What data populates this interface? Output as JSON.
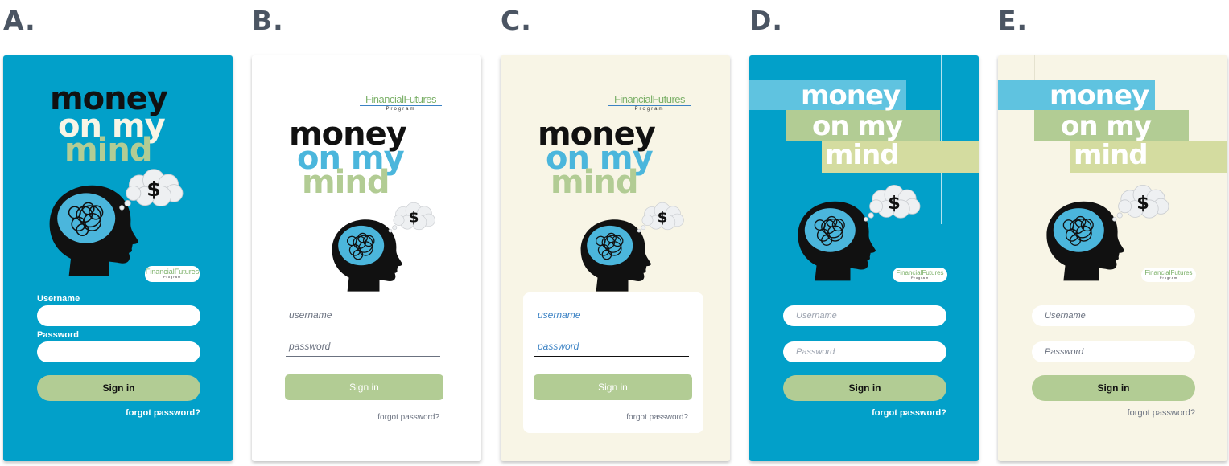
{
  "variants": [
    {
      "letter": "A.",
      "theme": "blue",
      "title": [
        "money",
        "on my",
        "mind"
      ],
      "ff": "FinancialFutures",
      "ff_program": "Program",
      "username_label": "Username",
      "password_label": "Password",
      "signin": "Sign in",
      "forgot": "forgot password?"
    },
    {
      "letter": "B.",
      "theme": "white",
      "title": [
        "money",
        "on my",
        "mind"
      ],
      "ff": "FinancialFutures",
      "ff_program": "Program",
      "username_ph": "username",
      "password_ph": "password",
      "signin": "Sign in",
      "forgot": "forgot password?"
    },
    {
      "letter": "C.",
      "theme": "cream",
      "title": [
        "money",
        "on my",
        "mind"
      ],
      "ff": "FinancialFutures",
      "ff_program": "Program",
      "username_ph": "username",
      "password_ph": "password",
      "signin": "Sign in",
      "forgot": "forgot password?"
    },
    {
      "letter": "D.",
      "theme": "blue-banded",
      "title": [
        "money",
        "on my",
        "mind"
      ],
      "ff": "FinancialFutures",
      "ff_program": "Program",
      "username_ph": "Username",
      "password_ph": "Password",
      "signin": "Sign in",
      "forgot": "forgot password?"
    },
    {
      "letter": "E.",
      "theme": "cream-banded",
      "title": [
        "money",
        "on my",
        "mind"
      ],
      "ff": "FinancialFutures",
      "ff_program": "Program",
      "username_ph": "Username",
      "password_ph": "Password",
      "signin": "Sign in",
      "forgot": "forgot password?"
    }
  ],
  "colors": {
    "blue": "#02a0c9",
    "cream": "#f8f5e6",
    "light_blue": "#5fc3e0",
    "sage": "#b2cc94",
    "pale_sage": "#d4dca0",
    "head_blue": "#4bb6dc",
    "black": "#111111"
  }
}
